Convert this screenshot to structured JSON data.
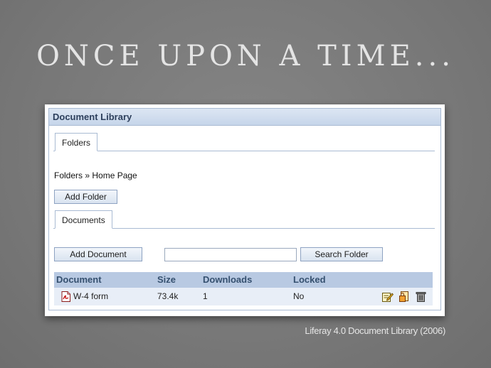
{
  "slide": {
    "title": "ONCE UPON A TIME...",
    "caption": "Liferay 4.0 Document Library (2006)"
  },
  "portlet": {
    "title": "Document Library",
    "folders_tab": "Folders",
    "breadcrumb": "Folders » Home Page",
    "add_folder_label": "Add Folder",
    "documents_tab": "Documents",
    "add_document_label": "Add Document",
    "search_value": "",
    "search_button_label": "Search Folder"
  },
  "table": {
    "headers": {
      "document": "Document",
      "size": "Size",
      "downloads": "Downloads",
      "locked": "Locked"
    },
    "rows": [
      {
        "document": "W-4 form",
        "size": "73.4k",
        "downloads": "1",
        "locked": "No",
        "file_icon": "pdf-file-icon",
        "actions": [
          "edit-icon",
          "permissions-icon",
          "delete-icon"
        ]
      }
    ]
  },
  "colors": {
    "background": "#7b7b7b",
    "header_gradient": "#c6d5ea",
    "table_header": "#b8c9e2",
    "row": "#e8eef7"
  }
}
